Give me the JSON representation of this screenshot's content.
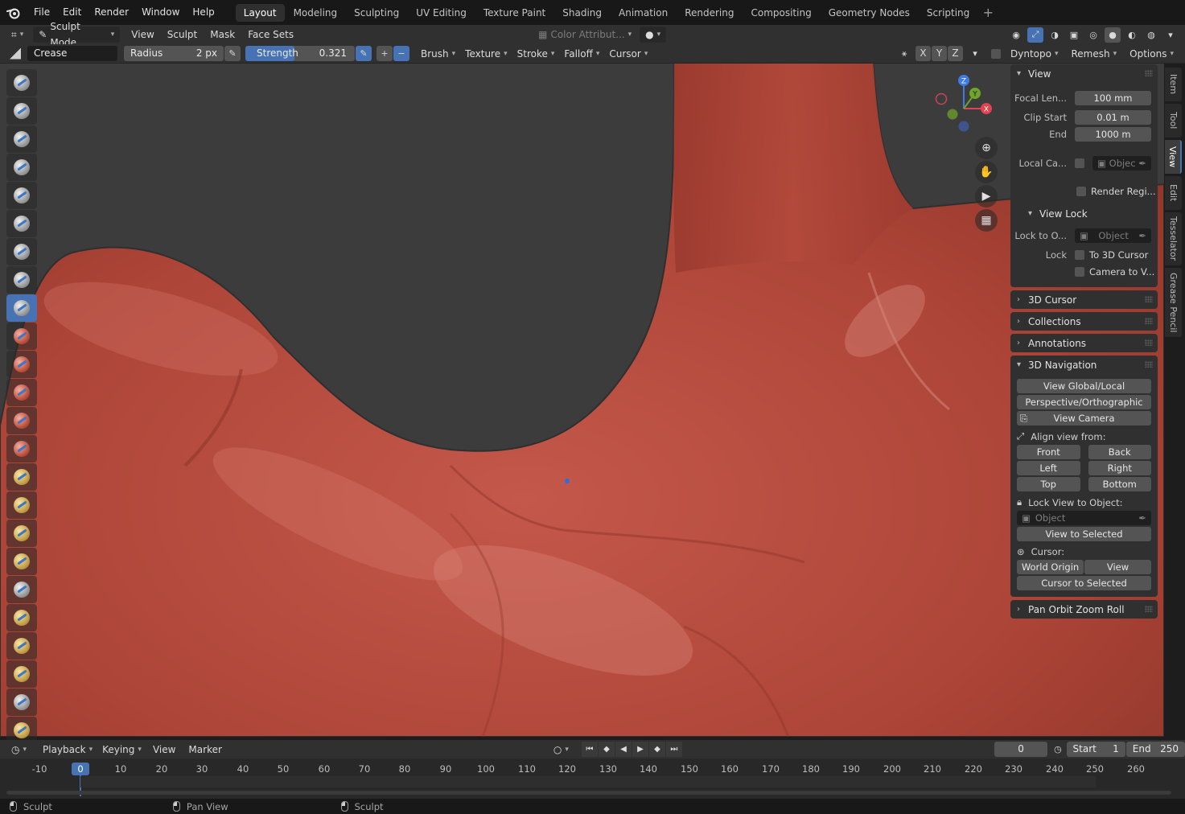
{
  "menubar": {
    "menus": [
      "File",
      "Edit",
      "Render",
      "Window",
      "Help"
    ],
    "workspaces": [
      "Layout",
      "Modeling",
      "Sculpting",
      "UV Editing",
      "Texture Paint",
      "Shading",
      "Animation",
      "Rendering",
      "Compositing",
      "Geometry Nodes",
      "Scripting"
    ],
    "active_workspace": "Layout",
    "add_workspace": "+"
  },
  "header": {
    "mode": "Sculpt Mode",
    "menus": [
      "View",
      "Sculpt",
      "Mask",
      "Face Sets"
    ],
    "color_attribute": "Color Attribut..."
  },
  "toolsettings": {
    "brush_name": "Crease",
    "radius_label": "Radius",
    "radius_value": "2 px",
    "strength_label": "Strength",
    "strength_value": "0.321",
    "plus": "+",
    "minus": "−",
    "dropdowns": [
      "Brush",
      "Texture",
      "Stroke",
      "Falloff",
      "Cursor"
    ],
    "axes": [
      "X",
      "Y",
      "Z"
    ],
    "dyntopo": "Dyntopo",
    "remesh": "Remesh",
    "options": "Options"
  },
  "npanel": {
    "view": {
      "title": "View",
      "focal_label": "Focal Len...",
      "focal_value": "100 mm",
      "clip_start_label": "Clip Start",
      "clip_start_value": "0.01 m",
      "clip_end_label": "End",
      "clip_end_value": "1000 m",
      "local_camera_label": "Local Ca...",
      "local_camera_placeholder": "Objec",
      "render_region": "Render Regi..."
    },
    "view_lock": {
      "title": "View Lock",
      "lock_to_object_label": "Lock to O...",
      "lock_to_object_placeholder": "Object",
      "lock_label": "Lock",
      "to_cursor": "To 3D Cursor",
      "camera_to_view": "Camera to V..."
    },
    "collapsed": [
      "3D Cursor",
      "Collections",
      "Annotations"
    ],
    "nav": {
      "title": "3D Navigation",
      "view_global_local": "View Global/Local",
      "persp_ortho": "Perspective/Orthographic",
      "view_camera": "View Camera",
      "align_label": "Align view from:",
      "front": "Front",
      "back": "Back",
      "left": "Left",
      "right": "Right",
      "top": "Top",
      "bottom": "Bottom",
      "lock_view_label": "Lock View to Object:",
      "object_placeholder": "Object",
      "view_to_selected": "View to Selected",
      "cursor_label": "Cursor:",
      "world_origin": "World Origin",
      "view": "View",
      "cursor_to_selected": "Cursor to Selected"
    },
    "pan_orbit": "Pan Orbit Zoom Roll"
  },
  "sidetabs": [
    "Item",
    "Tool",
    "View",
    "Edit",
    "Tesselator",
    "Grease Pencil"
  ],
  "active_sidetab": "View",
  "gizmo": {
    "x": "X",
    "y": "Y",
    "z": "Z"
  },
  "timeline": {
    "menus": [
      "Playback",
      "Keying",
      "View",
      "Marker"
    ],
    "current_frame": "0",
    "start_label": "Start",
    "start_value": "1",
    "end_label": "End",
    "end_value": "250",
    "ticks": [
      "-10",
      "0",
      "10",
      "20",
      "30",
      "40",
      "50",
      "60",
      "70",
      "80",
      "90",
      "100",
      "110",
      "120",
      "130",
      "140",
      "150",
      "160",
      "170",
      "180",
      "190",
      "200",
      "210",
      "220",
      "230",
      "240",
      "250",
      "260"
    ],
    "playhead_label": "0"
  },
  "status": {
    "left": "Sculpt",
    "middle": "Pan View",
    "right": "Sculpt"
  },
  "colors": {
    "accent": "#4772b3",
    "skin": "#b2483b",
    "background": "#3c3c3c"
  }
}
